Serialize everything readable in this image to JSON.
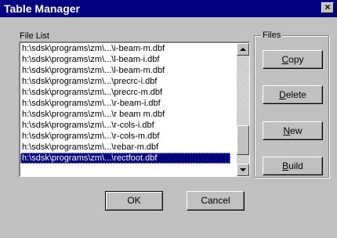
{
  "window": {
    "title": "Table Manager",
    "close_glyph": "×"
  },
  "file_list": {
    "label": "File List",
    "items": [
      "h:\\sdsk\\programs\\zm\\...\\i-beam-m.dbf",
      "h:\\sdsk\\programs\\zm\\...\\l-beam-i.dbf",
      "h:\\sdsk\\programs\\zm\\...\\l-beam-m.dbf",
      "h:\\sdsk\\programs\\zm\\...\\precrc-i.dbf",
      "h:\\sdsk\\programs\\zm\\...\\precrc-m.dbf",
      "h:\\sdsk\\programs\\zm\\...\\r-beam-i.dbf",
      "h:\\sdsk\\programs\\zm\\...\\r beam m.dbf",
      "h:\\sdsk\\programs\\zm\\...\\r-cols-i.dbf",
      "h:\\sdsk\\programs\\zm\\...\\r-cols-m.dbf",
      "h:\\sdsk\\programs\\zm\\...\\rebar-m.dbf",
      "h:\\sdsk\\programs\\zm\\...\\rectfoot.dbf"
    ],
    "selected_index": 10
  },
  "files_group": {
    "label": "Files",
    "copy_label": "Copy",
    "delete_label": "Delete",
    "new_label": "New",
    "build_label": "Build"
  },
  "dialog_buttons": {
    "ok_label": "OK",
    "cancel_label": "Cancel"
  },
  "colors": {
    "title_bar": "#000080",
    "selection": "#000080",
    "face": "#c0c0c0"
  }
}
